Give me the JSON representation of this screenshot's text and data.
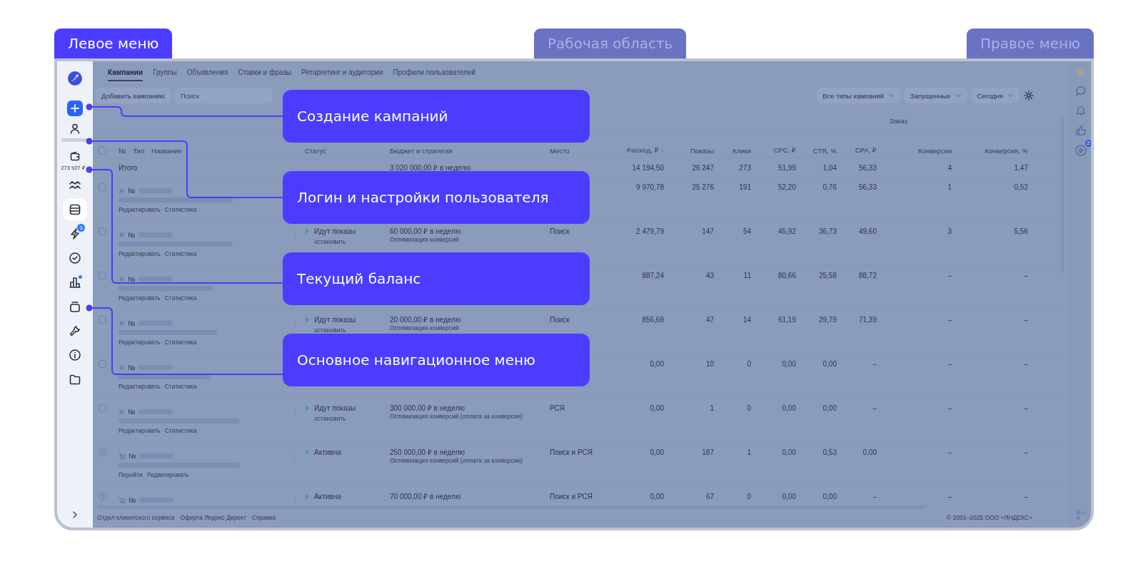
{
  "section_labels": [
    {
      "text": "Левое меню",
      "selected": true
    },
    {
      "text": "Рабочая область",
      "selected": false
    },
    {
      "text": "Правое меню",
      "selected": false
    }
  ],
  "sidebar": {
    "balance": "273 927 ₽",
    "nav_items": [
      {
        "selected": false,
        "notification": false
      },
      {
        "selected": true,
        "notification": false
      },
      {
        "selected": false,
        "notification": false,
        "badge": "3"
      },
      {
        "selected": false,
        "notification": false
      },
      {
        "selected": false,
        "notification": true
      },
      {
        "selected": false,
        "notification": false
      },
      {
        "selected": false,
        "notification": false
      },
      {
        "selected": false,
        "notification": false
      },
      {
        "selected": false,
        "notification": false
      }
    ]
  },
  "tabs": [
    {
      "label": "Кампании",
      "selected": true
    },
    {
      "label": "Группы",
      "selected": false
    },
    {
      "label": "Объявления",
      "selected": false
    },
    {
      "label": "Ставки и фразы",
      "selected": false
    },
    {
      "label": "Ретаргетинг и аудитории",
      "selected": false
    },
    {
      "label": "Профили пользователей",
      "selected": false
    }
  ],
  "toolbar": {
    "add_button": "Добавить кампанию",
    "search": {
      "placeholder": "Поиск"
    },
    "filters": [
      "Все типы кампаний",
      "Запущенные",
      "Сегодня"
    ]
  },
  "table": {
    "group_header": "Заказ",
    "select_all_checked": false,
    "name_headers": [
      "№",
      "Тип",
      "Название"
    ],
    "columns": [
      "Статус",
      "Бюджет и стратегия",
      "Место",
      "Расход, ₽ ↓",
      "Показы",
      "Клики",
      "CPC, ₽",
      "CTR, %",
      "CPA, ₽",
      "Конверсии",
      "Конверсия, %"
    ],
    "total": {
      "label": "Итого",
      "budget": "3 020 000,00 ₽ в неделю",
      "values": [
        "14 194,50",
        "26 247",
        "273",
        "51,99",
        "1,04",
        "56,33",
        "4",
        "1,47"
      ]
    },
    "rows": [
      {
        "kind": "network",
        "checked": false,
        "number": "№",
        "links": [
          "Редактировать",
          "Статистика"
        ],
        "values": [
          "9 970,78",
          "25 276",
          "191",
          "52,20",
          "0,76",
          "56,33",
          "1",
          "0,52"
        ]
      },
      {
        "kind": "network",
        "checked": false,
        "number": "№",
        "links": [
          "Редактировать",
          "Статистика"
        ],
        "status": "Идут показы",
        "status_action": "остановить",
        "budget": "60 000,00 ₽ в неделю",
        "strategy": "Оптимизация конверсий",
        "place": "Поиск",
        "values": [
          "2 479,79",
          "147",
          "54",
          "45,92",
          "36,73",
          "49,60",
          "3",
          "5,56"
        ]
      },
      {
        "kind": "network",
        "checked": false,
        "number": "№",
        "links": [
          "Редактировать",
          "Статистика"
        ],
        "values": [
          "887,24",
          "43",
          "11",
          "80,66",
          "25,58",
          "88,72",
          "–",
          "–"
        ]
      },
      {
        "kind": "network",
        "checked": false,
        "number": "№",
        "links": [
          "Редактировать",
          "Статистика"
        ],
        "status": "Идут показы",
        "status_action": "остановить",
        "budget": "20 000,00 ₽ в неделю",
        "strategy": "Оптимизация конверсий",
        "place": "Поиск",
        "values": [
          "856,69",
          "47",
          "14",
          "61,19",
          "29,79",
          "71,39",
          "–",
          "–"
        ]
      },
      {
        "kind": "network",
        "checked": false,
        "number": "№",
        "links": [
          "Редактировать",
          "Статистика"
        ],
        "values": [
          "0,00",
          "10",
          "0",
          "0,00",
          "0,00",
          "–",
          "–",
          "–"
        ]
      },
      {
        "kind": "network",
        "checked": false,
        "number": "№",
        "links": [
          "Редактировать",
          "Статистика"
        ],
        "status": "Идут показы",
        "status_action": "остановить",
        "budget": "300 000,00 ₽ в неделю",
        "strategy": "Оптимизация конверсий (оплата за конверсии)",
        "place": "РСЯ",
        "values": [
          "0,00",
          "1",
          "0",
          "0,00",
          "0,00",
          "–",
          "–",
          "–"
        ]
      },
      {
        "kind": "cart",
        "number": "№",
        "links": [
          "Перейти",
          "Редактировать"
        ],
        "status": "Активна",
        "budget": "250 000,00 ₽ в неделю",
        "strategy": "Оптимизация конверсий (оплата за конверсии)",
        "place": "Поиск и РСЯ",
        "values": [
          "0,00",
          "187",
          "1",
          "0,00",
          "0,53",
          "0,00",
          "–",
          "–"
        ]
      },
      {
        "kind": "cart",
        "number": "№",
        "status": "Активна",
        "budget": "70 000,00 ₽ в неделю",
        "place": "Поиск и РСЯ",
        "values": [
          "0,00",
          "67",
          "0",
          "0,00",
          "0,00",
          "–",
          "–",
          "–"
        ]
      }
    ]
  },
  "footer": {
    "links": [
      "Отдел клиентского сервиса",
      "Оферта Яндекс Директ",
      "Справка"
    ],
    "copyright": "© 2001–2025 ООО «ЯНДЕКС»"
  },
  "right_menu": {
    "video_badge": "2"
  },
  "callouts": [
    {
      "text": "Создание кампаний"
    },
    {
      "text": "Логин и настройки пользователя"
    },
    {
      "text": "Текущий баланс"
    },
    {
      "text": "Основное навигационное меню"
    }
  ]
}
